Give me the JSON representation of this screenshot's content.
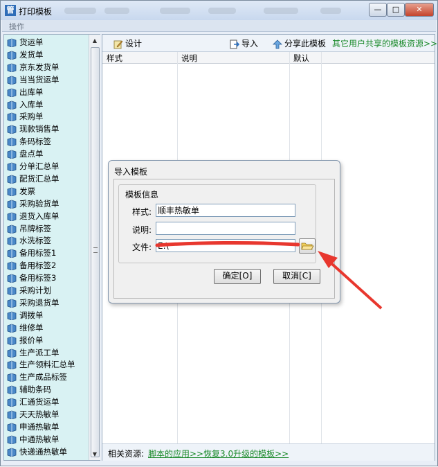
{
  "window": {
    "title": "打印模板",
    "minimize": "—",
    "maximize": "□",
    "close": "✕"
  },
  "menubar": {
    "operation": "操作"
  },
  "sidebar": {
    "items": [
      "货运单",
      "发货单",
      "京东发货单",
      "当当货运单",
      "出库单",
      "入库单",
      "采购单",
      "现款销售单",
      "条码标签",
      "盘点单",
      "分单汇总单",
      "配货汇总单",
      "发票",
      "采购验货单",
      "退货入库单",
      "吊牌标签",
      "水洗标签",
      "备用标签1",
      "备用标签2",
      "备用标签3",
      "采购计划",
      "采购退货单",
      "调拨单",
      "维修单",
      "报价单",
      "生产派工单",
      "生产领料汇总单",
      "生产成品标签",
      "辅助条码",
      "汇通货运单",
      "天天热敏单",
      "申通热敏单",
      "中通热敏单",
      "快递通热敏单"
    ]
  },
  "toolbar": {
    "design": "设计",
    "import": "导入",
    "share": "分享此模板",
    "others_link": "其它用户共享的模板资源>>"
  },
  "table": {
    "columns": [
      "样式",
      "说明",
      "默认"
    ]
  },
  "footer": {
    "label": "相关资源:",
    "link1": "脚本的应用>>",
    "link2": "恢复3.0升级的模板>>"
  },
  "dialog": {
    "title": "导入模板",
    "group_title": "模板信息",
    "style_label": "样式:",
    "style_value": "顺丰热敏单",
    "desc_label": "说明:",
    "desc_value": "",
    "file_label": "文件:",
    "file_value": "E:\\",
    "ok": "确定[O]",
    "cancel": "取消[C]"
  },
  "colors": {
    "sidebar_bg": "#d9f2f3",
    "link": "#1a8a2a",
    "annotation": "#e8372e",
    "titlebar": "#c8d8ee"
  }
}
